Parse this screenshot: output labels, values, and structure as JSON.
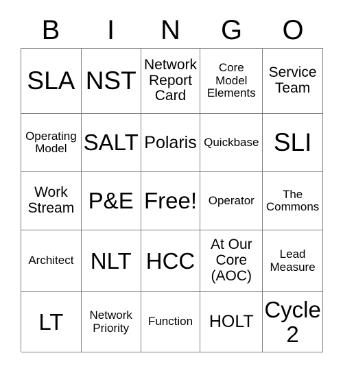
{
  "card": {
    "headers": [
      "B",
      "I",
      "N",
      "G",
      "O"
    ],
    "free_space_label": "Free!",
    "rows": [
      [
        {
          "text": "SLA",
          "size": "xl"
        },
        {
          "text": "NST",
          "size": "xl"
        },
        {
          "text": "Network Report Card",
          "size": "sm"
        },
        {
          "text": "Core Model Elements",
          "size": "xs"
        },
        {
          "text": "Service Team",
          "size": "sm"
        }
      ],
      [
        {
          "text": "Operating Model",
          "size": "xs"
        },
        {
          "text": "SALT",
          "size": "lg"
        },
        {
          "text": "Polaris",
          "size": "md"
        },
        {
          "text": "Quickbase",
          "size": "xs"
        },
        {
          "text": "SLI",
          "size": "xl"
        }
      ],
      [
        {
          "text": "Work Stream",
          "size": "sm"
        },
        {
          "text": "P&E",
          "size": "lg"
        },
        {
          "text": "Free!",
          "size": "lg"
        },
        {
          "text": "Operator",
          "size": "xs"
        },
        {
          "text": "The Commons",
          "size": "xs"
        }
      ],
      [
        {
          "text": "Architect",
          "size": "xs"
        },
        {
          "text": "NLT",
          "size": "lg"
        },
        {
          "text": "HCC",
          "size": "lg"
        },
        {
          "text": "At Our Core (AOC)",
          "size": "sm"
        },
        {
          "text": "Lead Measure",
          "size": "xs"
        }
      ],
      [
        {
          "text": "LT",
          "size": "lg"
        },
        {
          "text": "Network Priority",
          "size": "xs"
        },
        {
          "text": "Function",
          "size": "xs"
        },
        {
          "text": "HOLT",
          "size": "md"
        },
        {
          "text": "Cycle 2",
          "size": "lg"
        }
      ]
    ]
  },
  "style": {
    "border_color": "#808080",
    "text_color": "#000000",
    "background_color": "#ffffff"
  }
}
